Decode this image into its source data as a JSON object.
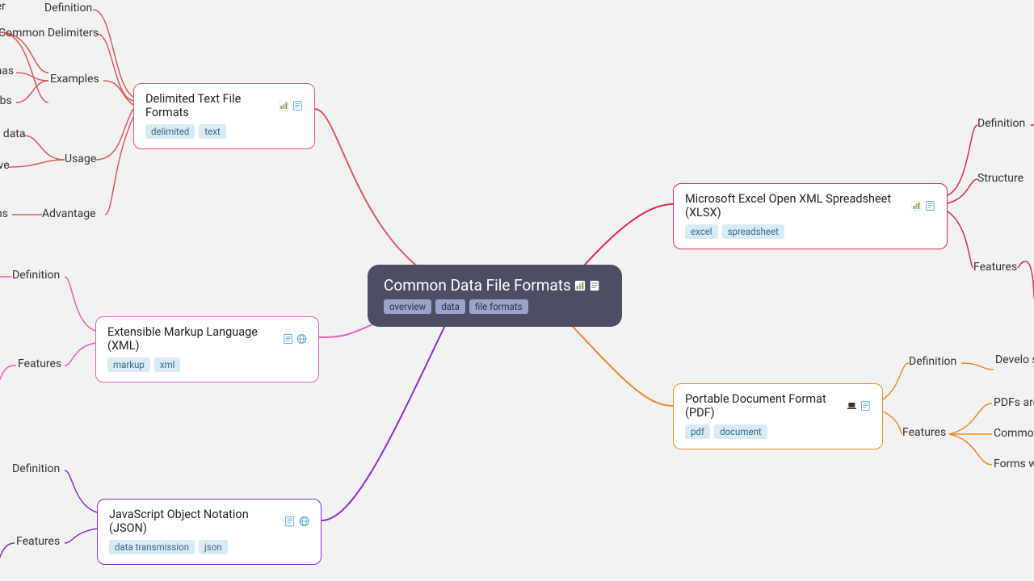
{
  "root": {
    "title": "Common Data File Formats",
    "tags": [
      "overview",
      "data",
      "file formats"
    ]
  },
  "nodes": {
    "delimited": {
      "title": "Delimited Text File Formats",
      "tags": [
        "delimited",
        "text"
      ],
      "color": "#dc5a5a"
    },
    "xlsx": {
      "title": "Microsoft Excel Open XML Spreadsheet (XLSX)",
      "tags": [
        "excel",
        "spreadsheet"
      ],
      "color": "#e0294b"
    },
    "xml": {
      "title": "Extensible Markup Language (XML)",
      "tags": [
        "markup",
        "xml"
      ],
      "color": "#e85fbe"
    },
    "pdf": {
      "title": "Portable Document Format (PDF)",
      "tags": [
        "pdf",
        "document"
      ],
      "color": "#f08a24"
    },
    "json": {
      "title": "JavaScript Object Notation (JSON)",
      "tags": [
        "data transmission",
        "json"
      ],
      "color": "#8a2ed6"
    }
  },
  "leaves": {
    "del_definition": "Definition",
    "del_common": "Common Delimiters",
    "del_mas": "mas",
    "del_abs": "abs",
    "del_examples": "Examples",
    "del_data": "ed data",
    "del_ave": "ave",
    "del_usage": "Usage",
    "del_ns": "ns",
    "del_advantage": "Advantage",
    "del_ter": "ter",
    "xlsx_definition": "Definition",
    "xlsx_structure": "Structure",
    "xlsx_features": "Features",
    "xml_definition": "Definition",
    "xml_features": "Features",
    "pdf_definition": "Definition",
    "pdf_develo": "Develo softwa",
    "pdf_features": "Features",
    "pdf_are": "PDFs are",
    "pdf_common": "Common",
    "pdf_forms": "Forms w",
    "json_definition": "Definition",
    "json_features": "Features"
  }
}
